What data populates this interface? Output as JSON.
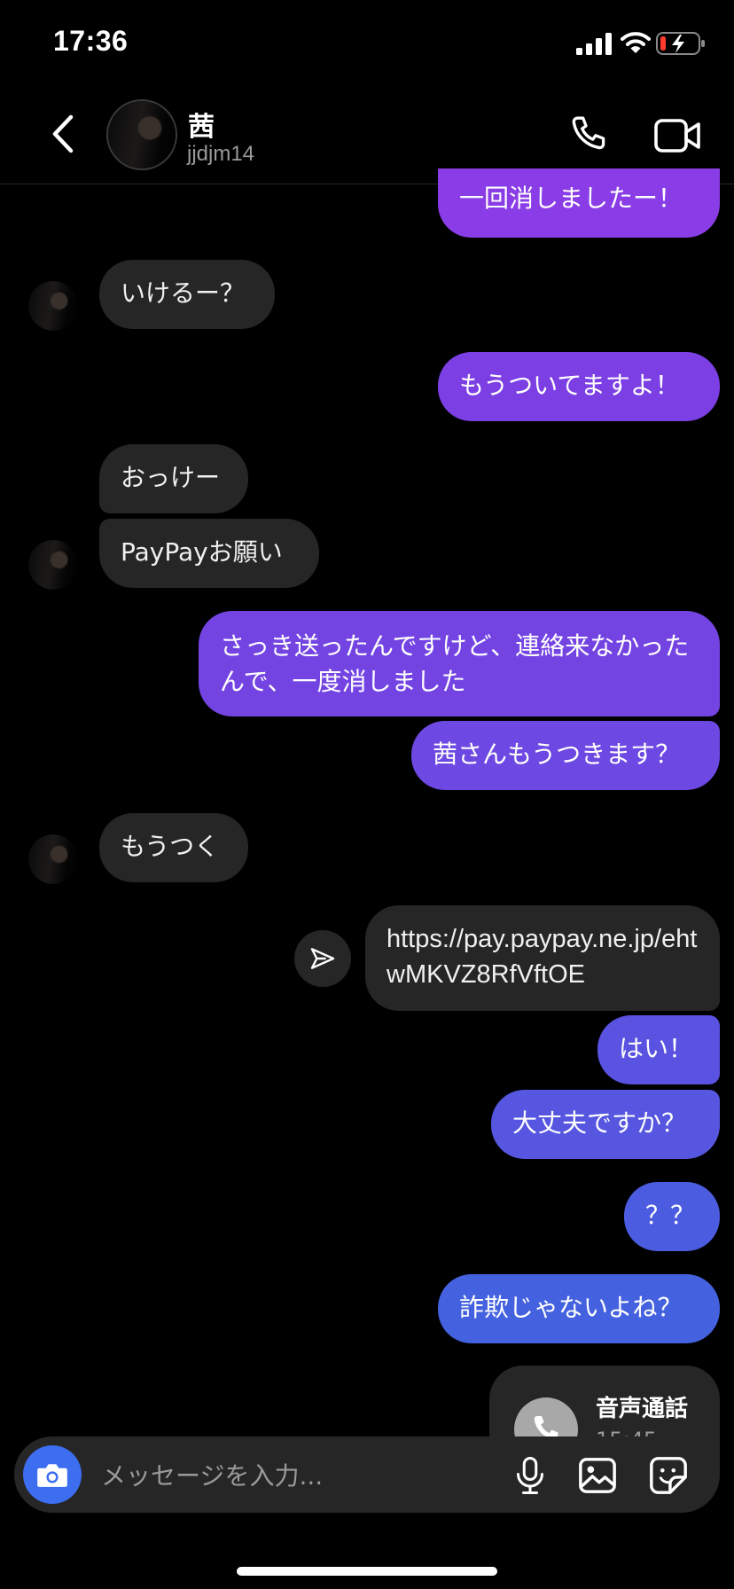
{
  "status_bar": {
    "time": "17:36"
  },
  "header": {
    "name": "茜",
    "username": "jjdjm14"
  },
  "messages": [
    {
      "text": "一回消しましたー！",
      "direction": "outgoing",
      "color": "#8a3de6"
    },
    {
      "text": "いけるー？",
      "direction": "incoming"
    },
    {
      "text": "もうついてますよ！",
      "direction": "outgoing",
      "color": "#7b3fe4"
    },
    {
      "text": "おっけー",
      "direction": "incoming"
    },
    {
      "text": "PayPayお願い",
      "direction": "incoming"
    },
    {
      "text": "さっき送ったんですけど、連絡来なかったんで、一度消しました",
      "direction": "outgoing",
      "color": "#7444e3"
    },
    {
      "text": "茜さんもうつきます？",
      "direction": "outgoing",
      "color": "#6d48e2"
    },
    {
      "text": "もうつく",
      "direction": "incoming"
    },
    {
      "text": "https://pay.paypay.ne.jp/ehtwMKVZ8RfVftOE",
      "direction": "outgoing",
      "style": "link"
    },
    {
      "text": "はい！",
      "direction": "outgoing",
      "color": "#5a52e0"
    },
    {
      "text": "大丈夫ですか？",
      "direction": "outgoing",
      "color": "#5656e0"
    },
    {
      "text": "？？",
      "direction": "outgoing",
      "color": "#4b5ce0"
    },
    {
      "text": "詐欺じゃないよね？",
      "direction": "outgoing",
      "color": "#4461df"
    }
  ],
  "call_card": {
    "title": "音声通話",
    "time": "15:45"
  },
  "composer": {
    "placeholder": "メッセージを入力..."
  },
  "icons": {
    "back": "chevron-left-icon",
    "call": "phone-icon",
    "video": "video-camera-icon",
    "share": "paper-plane-icon",
    "camera": "camera-icon",
    "mic": "microphone-icon",
    "gallery": "image-icon",
    "sticker": "sticker-icon"
  },
  "colors": {
    "accent_blue": "#3d6ef0",
    "incoming_bubble": "#262626"
  }
}
